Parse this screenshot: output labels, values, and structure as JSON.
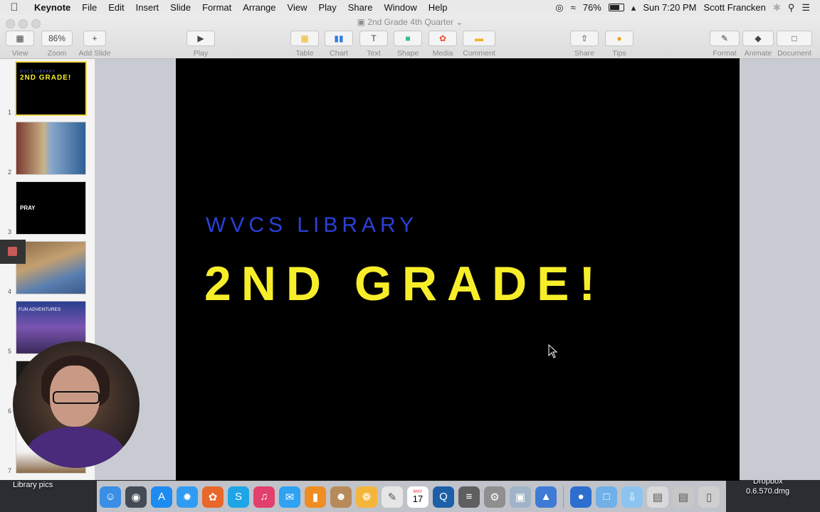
{
  "menubar": {
    "app": "Keynote",
    "menus": [
      "File",
      "Edit",
      "Insert",
      "Slide",
      "Format",
      "Arrange",
      "View",
      "Play",
      "Share",
      "Window",
      "Help"
    ],
    "battery": "76%",
    "clock": "Sun 7:20 PM",
    "user": "Scott Francken"
  },
  "window": {
    "title": "2nd Grade 4th Quarter"
  },
  "toolbar": {
    "view": "View",
    "zoom_value": "86%",
    "zoom": "Zoom",
    "add_slide": "Add Slide",
    "play": "Play",
    "table": "Table",
    "chart": "Chart",
    "text": "Text",
    "shape": "Shape",
    "media": "Media",
    "comment": "Comment",
    "share": "Share",
    "tips": "Tips",
    "format": "Format",
    "animate": "Animate",
    "document": "Document"
  },
  "navigator": {
    "slides": [
      {
        "number": "1",
        "sub": "WVCS LIBRARY",
        "title": "2ND GRADE!"
      },
      {
        "number": "2"
      },
      {
        "number": "3",
        "title": "PRAY"
      },
      {
        "number": "4"
      },
      {
        "number": "5",
        "title": "FUN ADVENTURES"
      },
      {
        "number": "6"
      },
      {
        "number": "7"
      }
    ]
  },
  "slide": {
    "subtitle": "WVCS LIBRARY",
    "title": "2ND GRADE!"
  },
  "desktop": {
    "folder_label": "Library pics",
    "file_label_1": "Dropbox",
    "file_label_2": "0.6.570.dmg"
  },
  "dock": {
    "apps": [
      {
        "icon": "finder-icon",
        "color": "#3a8ee6"
      },
      {
        "icon": "launchpad-icon",
        "color": "#444b55"
      },
      {
        "icon": "app-store-icon",
        "color": "#1d8bf0"
      },
      {
        "icon": "safari-icon",
        "color": "#2f9bf2"
      },
      {
        "icon": "firefox-icon",
        "color": "#e8672a"
      },
      {
        "icon": "skype-icon",
        "color": "#1ea5e8"
      },
      {
        "icon": "itunes-icon",
        "color": "#e23f6c"
      },
      {
        "icon": "messages-icon",
        "color": "#2fa2f2"
      },
      {
        "icon": "ibooks-icon",
        "color": "#f08d22"
      },
      {
        "icon": "contacts-icon",
        "color": "#b78a5a"
      },
      {
        "icon": "photos-icon",
        "color": "#f4b63a"
      },
      {
        "icon": "textedit-icon",
        "color": "#e6e6e6"
      },
      {
        "icon": "calendar-icon",
        "color": "#ffffff"
      },
      {
        "icon": "quicktime-icon",
        "color": "#1d5fa8"
      },
      {
        "icon": "calculator-icon",
        "color": "#5f5f5f"
      },
      {
        "icon": "system-preferences-icon",
        "color": "#8f8f8f"
      },
      {
        "icon": "preview-icon",
        "color": "#9fb4c8"
      },
      {
        "icon": "keynote-icon",
        "color": "#3f7bd6"
      },
      {
        "icon": "globe-icon",
        "color": "#2c6fd0"
      },
      {
        "icon": "folder-icon",
        "color": "#6fb0e8"
      },
      {
        "icon": "downloads-icon",
        "color": "#8cc4ef"
      },
      {
        "icon": "document-stack-icon",
        "color": "#d9d9d9"
      },
      {
        "icon": "screenshot-stack-icon",
        "color": "#c7c7c7"
      },
      {
        "icon": "trash-icon",
        "color": "#cfcfcf"
      }
    ],
    "calendar_month": "MAY",
    "calendar_day": "17"
  }
}
